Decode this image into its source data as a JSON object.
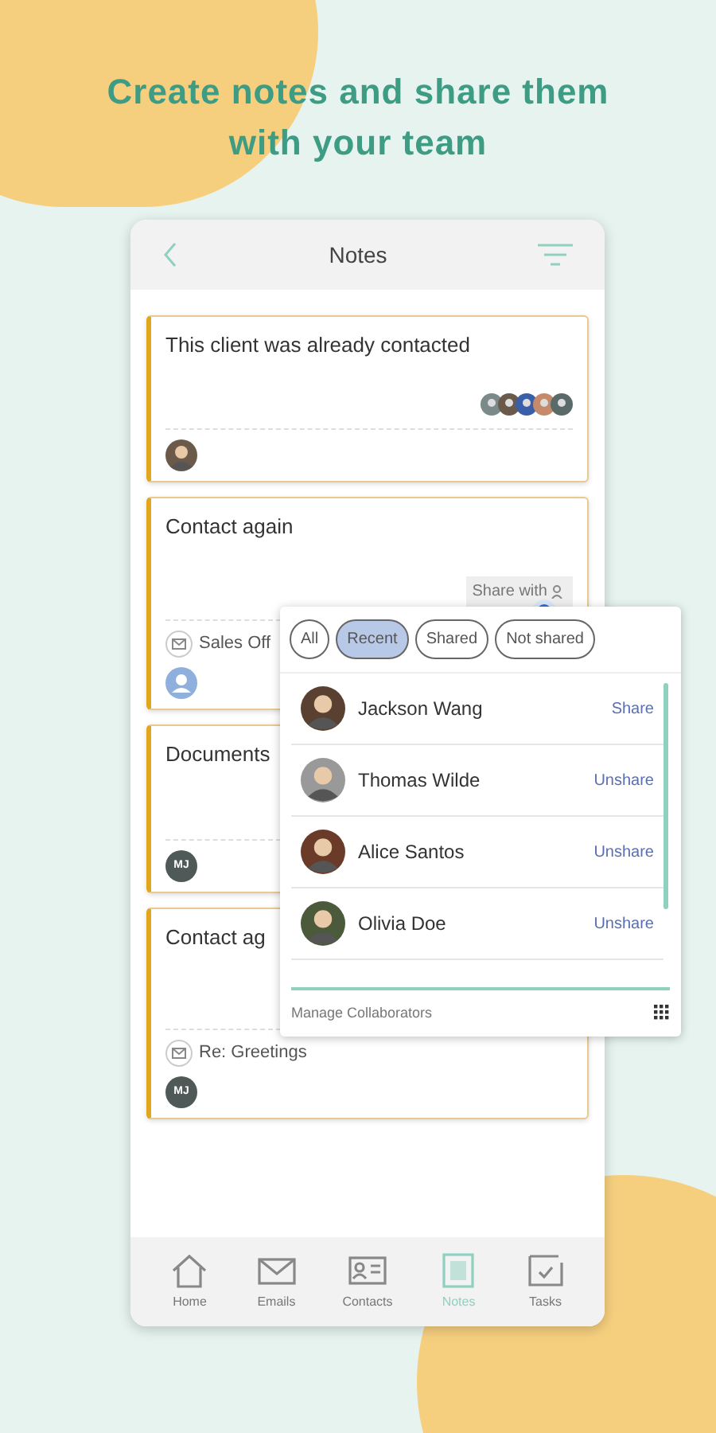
{
  "headline": "Create notes and share them with your team",
  "header": {
    "title": "Notes"
  },
  "notes": [
    {
      "title": "This client was already contacted",
      "shared_avatars": true,
      "owner": {
        "kind": "photo"
      }
    },
    {
      "title": "Contact again",
      "shared_avatars": false,
      "share_button": "Share with",
      "email": "Sales Off",
      "owner": {
        "kind": "placeholder"
      }
    },
    {
      "title": "Documents",
      "shared_avatars": false,
      "owner": {
        "kind": "initials",
        "initials": "MJ"
      }
    },
    {
      "title": "Contact ag",
      "shared_avatars": false,
      "email": "Re: Greetings",
      "owner": {
        "kind": "initials",
        "initials": "MJ"
      }
    }
  ],
  "share_popup": {
    "filters": [
      {
        "label": "All",
        "selected": false
      },
      {
        "label": "Recent",
        "selected": true
      },
      {
        "label": "Shared",
        "selected": false
      },
      {
        "label": "Not shared",
        "selected": false
      }
    ],
    "collaborators": [
      {
        "name": "Jackson Wang",
        "action": "Share"
      },
      {
        "name": "Thomas Wilde",
        "action": "Unshare"
      },
      {
        "name": "Alice Santos",
        "action": "Unshare"
      },
      {
        "name": "Olivia Doe",
        "action": "Unshare"
      }
    ],
    "footer": "Manage Collaborators"
  },
  "tab_bar": [
    {
      "label": "Home",
      "selected": false
    },
    {
      "label": "Emails",
      "selected": false
    },
    {
      "label": "Contacts",
      "selected": false
    },
    {
      "label": "Notes",
      "selected": true
    },
    {
      "label": "Tasks",
      "selected": false
    }
  ]
}
